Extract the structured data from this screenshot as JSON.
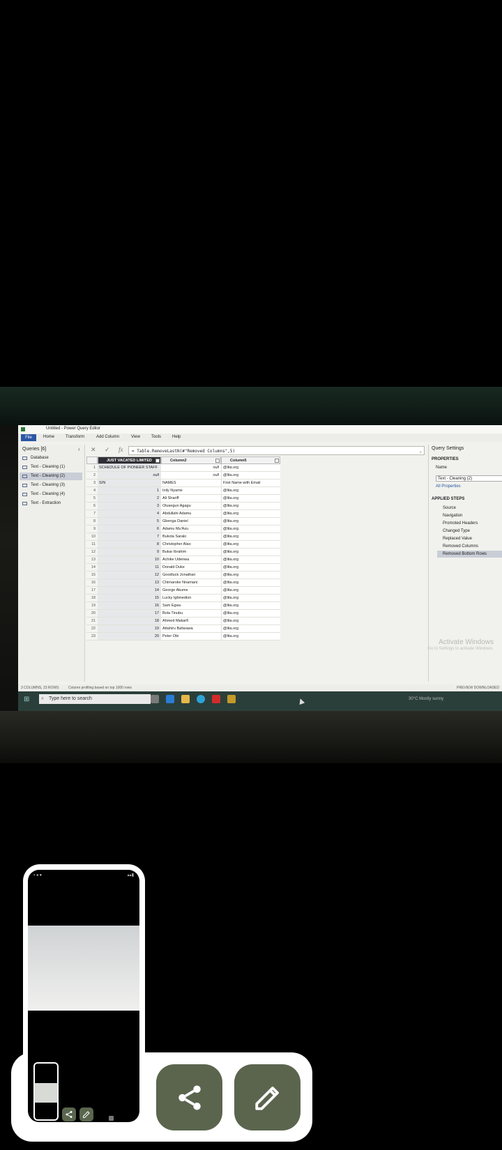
{
  "app": {
    "title": "Untitled - Power Query Editor",
    "ribbon_tabs": [
      "File",
      "Home",
      "Transform",
      "Add Column",
      "View",
      "Tools",
      "Help"
    ]
  },
  "queries": {
    "header": "Queries [6]",
    "items": [
      "Database",
      "Text - Cleaning (1)",
      "Text - Cleaning (2)",
      "Text - Cleaning (3)",
      "Text - Cleaning (4)",
      "Text - Extraction"
    ],
    "selected_index": 2
  },
  "formula_bar": {
    "fx": "fx",
    "formula": "= Table.RemoveLastN(#\"Removed Columns\",5)"
  },
  "table": {
    "columns": [
      "JUST VACATED LIMITED",
      "Column2",
      "Column5"
    ],
    "rows": [
      {
        "idx": "1",
        "c1": "SCHEDULE OF PIONEER STAFF",
        "c2": "null",
        "c5": "@lita.org"
      },
      {
        "idx": "2",
        "c1": "null",
        "c2": "null",
        "c5": "@lita.org"
      },
      {
        "idx": "3",
        "c1": "S/N",
        "c2": "NAMES",
        "c5": "First Name with Email"
      },
      {
        "idx": "4",
        "c1": "1",
        "c2": "Inily Nyame",
        "c5": "@lita.org"
      },
      {
        "idx": "5",
        "c1": "2",
        "c2": "Ali Shariff",
        "c5": "@lita.org"
      },
      {
        "idx": "6",
        "c1": "3",
        "c2": "Olusegun Agagu",
        "c5": "@lita.org"
      },
      {
        "idx": "7",
        "c1": "4",
        "c2": "Abdullahi Adamu",
        "c5": "@lita.org"
      },
      {
        "idx": "8",
        "c1": "5",
        "c2": "Gbenga Daniel",
        "c5": "@lita.org"
      },
      {
        "idx": "9",
        "c1": "6",
        "c2": "Adamu Mu'Azu",
        "c5": "@lita.org"
      },
      {
        "idx": "10",
        "c1": "7",
        "c2": "Bukola Saraki",
        "c5": "@lita.org"
      },
      {
        "idx": "11",
        "c1": "8",
        "c2": "Christopher Alao",
        "c5": "@lita.org"
      },
      {
        "idx": "12",
        "c1": "9",
        "c2": "Bukar Ibrahim",
        "c5": "@lita.org"
      },
      {
        "idx": "13",
        "c1": "10",
        "c2": "Achike Udenwa",
        "c5": "@lita.org"
      },
      {
        "idx": "14",
        "c1": "11",
        "c2": "Donald Duke",
        "c5": "@lita.org"
      },
      {
        "idx": "15",
        "c1": "12",
        "c2": "Goodluck Jonathan",
        "c5": "@lita.org"
      },
      {
        "idx": "16",
        "c1": "13",
        "c2": "Chimaroke Nnamani",
        "c5": "@lita.org"
      },
      {
        "idx": "17",
        "c1": "14",
        "c2": "George Akume",
        "c5": "@lita.org"
      },
      {
        "idx": "18",
        "c1": "15",
        "c2": "Lucky Igbinedion",
        "c5": "@lita.org"
      },
      {
        "idx": "19",
        "c1": "16",
        "c2": "Sam Egwu",
        "c5": "@lita.org"
      },
      {
        "idx": "20",
        "c1": "17",
        "c2": "Bola Tinubu",
        "c5": "@lita.org"
      },
      {
        "idx": "21",
        "c1": "18",
        "c2": "Ahmed Makarfi",
        "c5": "@lita.org"
      },
      {
        "idx": "22",
        "c1": "19",
        "c2": "Attahiru Bafarawa",
        "c5": "@lita.org"
      },
      {
        "idx": "23",
        "c1": "20",
        "c2": "Peter Obi",
        "c5": "@lita.org"
      }
    ]
  },
  "settings": {
    "title": "Query Settings",
    "properties": "PROPERTIES",
    "name_label": "Name",
    "name_value": "Text - Cleaning (2)",
    "all_properties": "All Properties",
    "applied_steps": "APPLIED STEPS",
    "steps": [
      "Source",
      "Navigation",
      "Promoted Headers",
      "Changed Type",
      "Replaced Value",
      "Removed Columns",
      "Removed Bottom Rows"
    ]
  },
  "status_bar": {
    "left": "3 COLUMNS, 23 ROWS",
    "profiling": "Column profiling based on top 1000 rows",
    "right": "PREVIEW DOWNLOADED"
  },
  "watermark": {
    "line1": "Activate Windows",
    "line2": "Go to Settings to activate Windows."
  },
  "taskbar": {
    "search": "Type here to search",
    "weather": "30°C  Mostly sunny"
  },
  "colors": {
    "file_tab": "#2a56a4",
    "share_button": "#5b654e",
    "overlay_bg": "#ffffff"
  },
  "screenshot_overlay": {
    "share_icon": "share-icon",
    "edit_icon": "pencil-icon"
  }
}
